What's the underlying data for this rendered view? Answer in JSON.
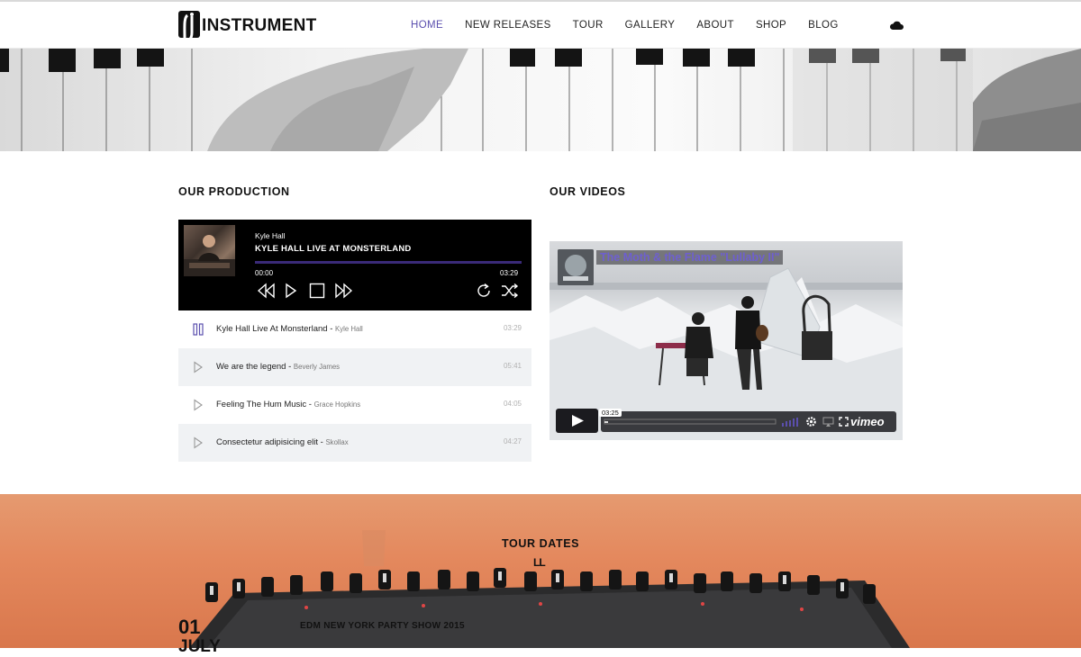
{
  "brand": {
    "name": "INSTRUMENT"
  },
  "nav": {
    "items": [
      "HOME",
      "NEW RELEASES",
      "TOUR",
      "GALLERY",
      "ABOUT",
      "SHOP",
      "BLOG"
    ],
    "active": "HOME"
  },
  "production": {
    "title": "OUR PRODUCTION",
    "player": {
      "artist": "Kyle Hall",
      "track": "KYLE HALL LIVE AT MONSTERLAND",
      "current_time": "00:00",
      "total_time": "03:29"
    },
    "playlist": [
      {
        "name": "Kyle Hall Live At Monsterland",
        "by": "Kyle Hall",
        "duration": "03:29",
        "playing": true
      },
      {
        "name": "We are the legend",
        "by": "Beverly James",
        "duration": "05:41",
        "playing": false
      },
      {
        "name": "Feeling The Hum Music",
        "by": "Grace Hopkins",
        "duration": "04:05",
        "playing": false
      },
      {
        "name": "Consectetur adipisicing elit",
        "by": "Skollax",
        "duration": "04:27",
        "playing": false
      }
    ]
  },
  "videos": {
    "title": "OUR VIDEOS",
    "video_title": "The Moth & the Flame \"Lullaby II\"",
    "time": "03:25",
    "provider": "vimeo"
  },
  "tour": {
    "title": "TOUR DATES",
    "deco": "LL",
    "day": "01",
    "month": "JULY",
    "event": "EDM NEW YORK PARTY SHOW 2015"
  },
  "colors": {
    "accent": "#5b4fae",
    "player_bg": "#000000",
    "progress": "#3a2a78",
    "row_alt": "#f0f2f4",
    "tour_bg": "#e4895e"
  }
}
